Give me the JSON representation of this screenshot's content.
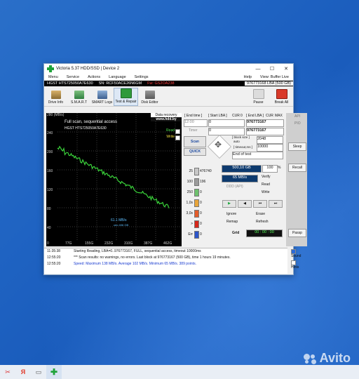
{
  "window": {
    "title": "Victoria 5.37 HDD/SSD | Device 2",
    "controls": {
      "minimize": "—",
      "maximize": "☐",
      "close": "✕"
    }
  },
  "menu": [
    "Menu",
    "Service",
    "Actions",
    "Language",
    "Settings",
    "Help"
  ],
  "menu_right": "View: Buffer Live",
  "info": {
    "model": "HGST HTS725050A7E630",
    "sn": "SN: RCF50ACE26N6GM",
    "fw": "Fw: GS2OA238",
    "lba": "976773168 LBA (500 GB)"
  },
  "toolbar": {
    "items": [
      "Drive Info",
      "S.M.A.R.T",
      "SMART Logs",
      "Test & Repair",
      "Disk Editor"
    ],
    "pause": "Pause",
    "break_all": "Break All"
  },
  "graph": {
    "y_unit": "280 (MB/s)",
    "y_ticks": [
      "240",
      "200",
      "160",
      "120",
      "80",
      "40"
    ],
    "x_ticks": [
      "0",
      "77G",
      "155G",
      "232G",
      "310G",
      "387G",
      "462G"
    ],
    "scan_title": "Full scan, sequential access",
    "model": "HGST HTS725050A7E630",
    "data_recovery": "Data recovery",
    "site": "www.hdd.by",
    "read": "Read",
    "write": "Write",
    "speed_label": "61.1 MB/s",
    "speed_sub": "ceo 406 GB"
  },
  "panel": {
    "end_time_label": "[ End time ]",
    "start_lba_label": "[ Start LBA ]",
    "cur_label": "CUR",
    "zero_label": "0",
    "end_lba_label": "[ End LBA ]",
    "cur2_label": "CUR",
    "max_label": "MAX",
    "time_value": "12:00",
    "start_lba_value": "0",
    "end_lba_value": "976773167",
    "timer_label": "Timer",
    "timer_value": "0",
    "end_lba_value2": "976773167",
    "scan": "Scan",
    "quick": "QUICK",
    "block_size_label": "[ block size ]",
    "auto_label": "auto",
    "block_size": "2048",
    "timeout_label": "[ timeout,ms ]",
    "timeout": "10000",
    "end_of_test": "End of test",
    "blocks": [
      {
        "ms": "25",
        "count": "476740"
      },
      {
        "ms": "100",
        "count": "196"
      },
      {
        "ms": "250",
        "count": "0"
      },
      {
        "ms": "1,0s",
        "count": "0"
      },
      {
        "ms": "3,0s",
        "count": "0"
      },
      {
        "ms": ">",
        "count": "0"
      },
      {
        "ms": "Err",
        "count": "0"
      }
    ],
    "size_done": "500,10 GB",
    "percent": "100",
    "percent_unit": "%",
    "speed": "65 MB/s",
    "ddd": "DDD (API)",
    "verify": "Verify",
    "read": "Read",
    "write": "Write",
    "ignore": "Ignore",
    "erase": "Erase",
    "remap": "Remap",
    "refresh": "Refresh",
    "grid": "Grid",
    "grid_value": "00 : 00 : 00"
  },
  "sidebar": {
    "api": "API",
    "pio": "PIO",
    "sleep": "Sleep",
    "recall": "Recall",
    "passp": "Passp"
  },
  "log": [
    {
      "time": "11:35:38",
      "text": "Starting Reading, LBA=0..976773167, FULL, sequential access, timeout 10000ms",
      "color": "#111111"
    },
    {
      "time": "12:55:20",
      "text": "*** Scan results: no warnings, no errors. Last block at 976773167 (500 GB), time 1 hours 19 minutes.",
      "color": "#111111"
    },
    {
      "time": "12:55:20",
      "text": "Speed: Maximum 138 MB/s. Average 102 MB/s. Minimum 65 MB/s. 389 points.",
      "color": "#1a3cd0"
    }
  ],
  "log_options": {
    "sound": "Sound",
    "hints": "Hints"
  },
  "watermark": "Avito"
}
